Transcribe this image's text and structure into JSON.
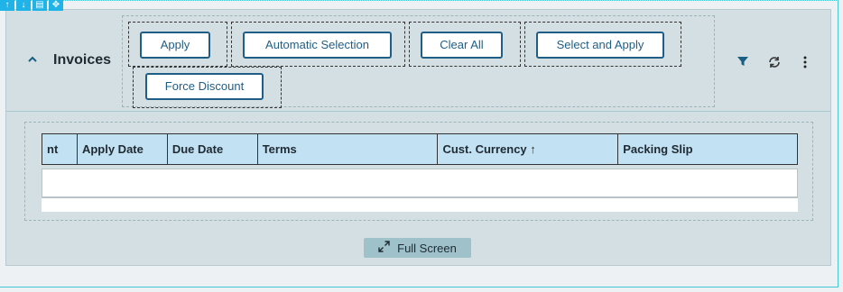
{
  "edit_toolbar": {
    "icons": [
      "arrow-up-icon",
      "arrow-down-icon",
      "trash-icon",
      "move-icon"
    ]
  },
  "panel": {
    "title": "Invoices",
    "actions": [
      {
        "label": "Apply"
      },
      {
        "label": "Automatic Selection"
      },
      {
        "label": "Clear All"
      },
      {
        "label": "Select and Apply"
      },
      {
        "label": "Force Discount"
      }
    ],
    "right_icons": [
      "filter-icon",
      "refresh-icon",
      "more-vertical-icon"
    ]
  },
  "grid": {
    "columns": [
      {
        "label": "nt"
      },
      {
        "label": "Apply Date"
      },
      {
        "label": "Due Date"
      },
      {
        "label": "Terms"
      },
      {
        "label": "Cust. Currency",
        "sort": "↑"
      },
      {
        "label": "Packing Slip"
      }
    ]
  },
  "footer": {
    "fullscreen_label": "Full Screen"
  },
  "colors": {
    "accent": "#1f5e86",
    "header_bg": "#c2e1f2",
    "panel_bg": "#d3dfe3",
    "toolbar": "#1fb3e8"
  }
}
